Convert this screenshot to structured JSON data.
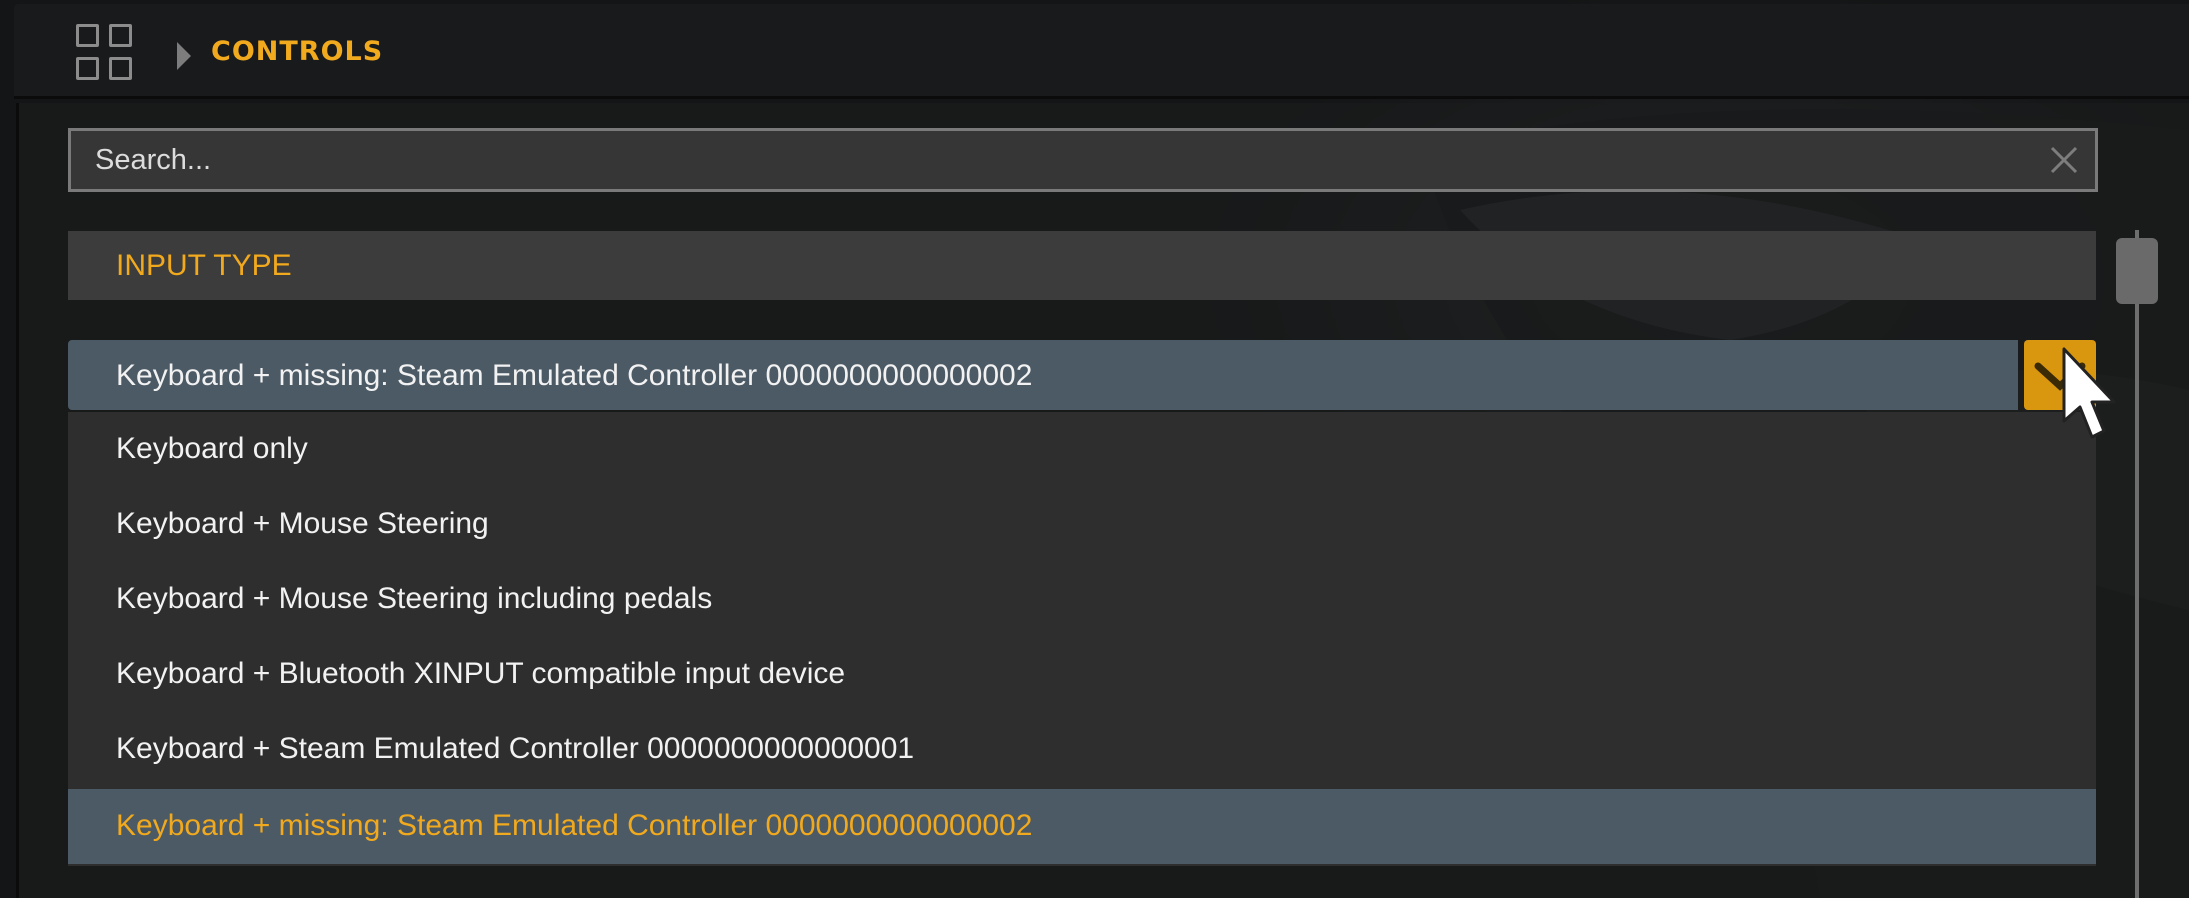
{
  "header": {
    "apps_icon": "apps-grid-icon",
    "breadcrumb_icon": "chevron-right-icon",
    "title": "CONTROLS"
  },
  "search": {
    "placeholder": "Search...",
    "value": "",
    "clear_icon": "close-icon"
  },
  "section": {
    "title": "INPUT TYPE"
  },
  "input_type": {
    "selected": "Keyboard + missing: Steam Emulated Controller 0000000000000002",
    "toggle_icon": "chevron-down-icon",
    "expanded": true,
    "options": [
      {
        "label": "Keyboard only"
      },
      {
        "label": "Keyboard + Mouse Steering"
      },
      {
        "label": "Keyboard + Mouse Steering including pedals"
      },
      {
        "label": "Keyboard + Bluetooth XINPUT compatible input device"
      },
      {
        "label": "Keyboard + Steam Emulated Controller 0000000000000001"
      },
      {
        "label": "Keyboard + missing: Steam Emulated Controller 0000000000000002",
        "selected": true
      }
    ]
  },
  "colors": {
    "accent": "#f1a91d",
    "selected_row": "#4c5a66",
    "toggle_button": "#d9960f"
  }
}
